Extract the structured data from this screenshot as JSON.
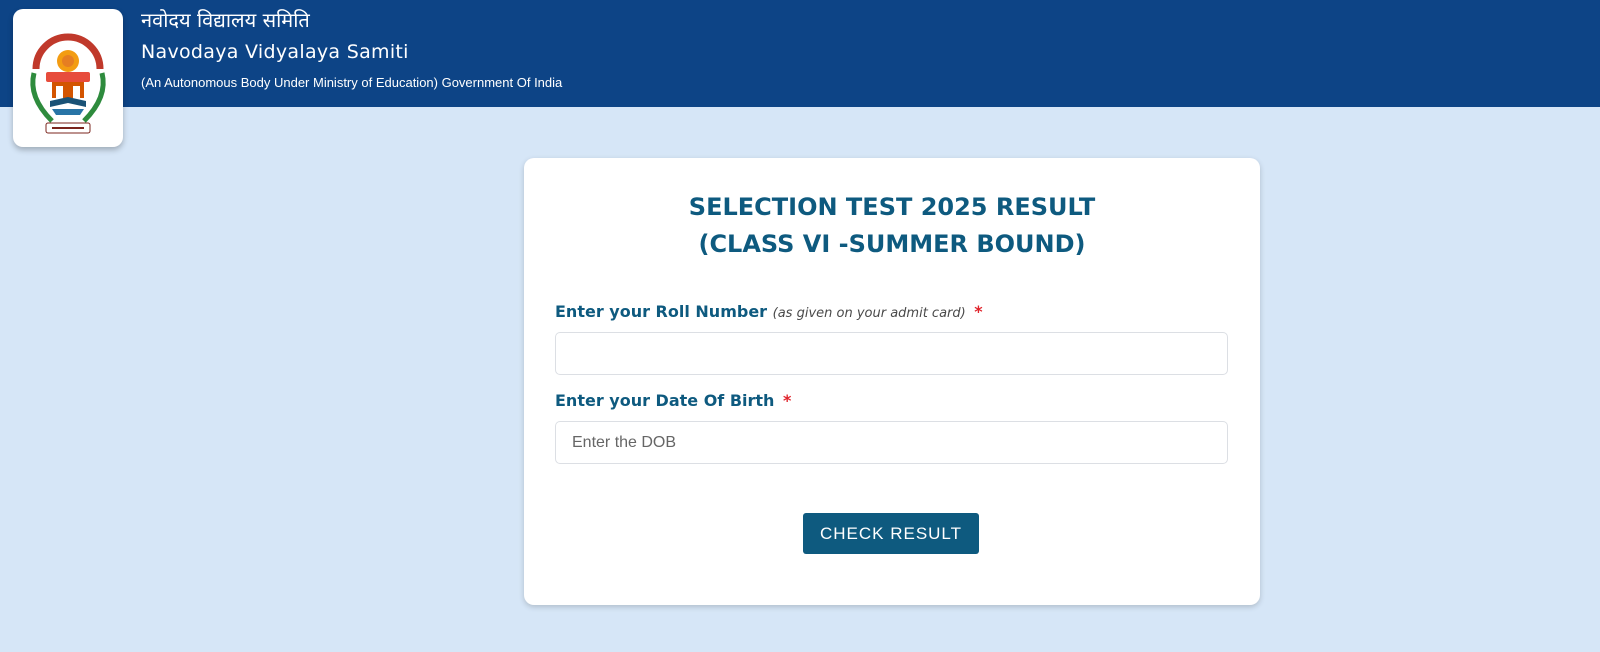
{
  "header": {
    "title_hindi": "नवोदय विद्यालय समिति",
    "title_english": "Navodaya Vidyalaya Samiti",
    "subtitle": "(An Autonomous Body Under Ministry of Education) Government Of India",
    "logo_icon": "nvs-emblem-logo"
  },
  "card": {
    "title_line1": "SELECTION TEST 2025 RESULT",
    "title_line2": "(CLASS VI -SUMMER BOUND)",
    "roll_label": "Enter your Roll Number",
    "roll_hint": "(as given on your admit card)",
    "required_marker": "*",
    "roll_value": "",
    "roll_placeholder": "",
    "dob_label": "Enter your Date Of Birth",
    "dob_value": "",
    "dob_placeholder": "Enter the DOB",
    "button_label": "CHECK RESULT"
  },
  "colors": {
    "header_bg": "#0d4486",
    "page_bg": "#d6e6f7",
    "accent": "#0e5a7f",
    "required": "#e0242c"
  }
}
